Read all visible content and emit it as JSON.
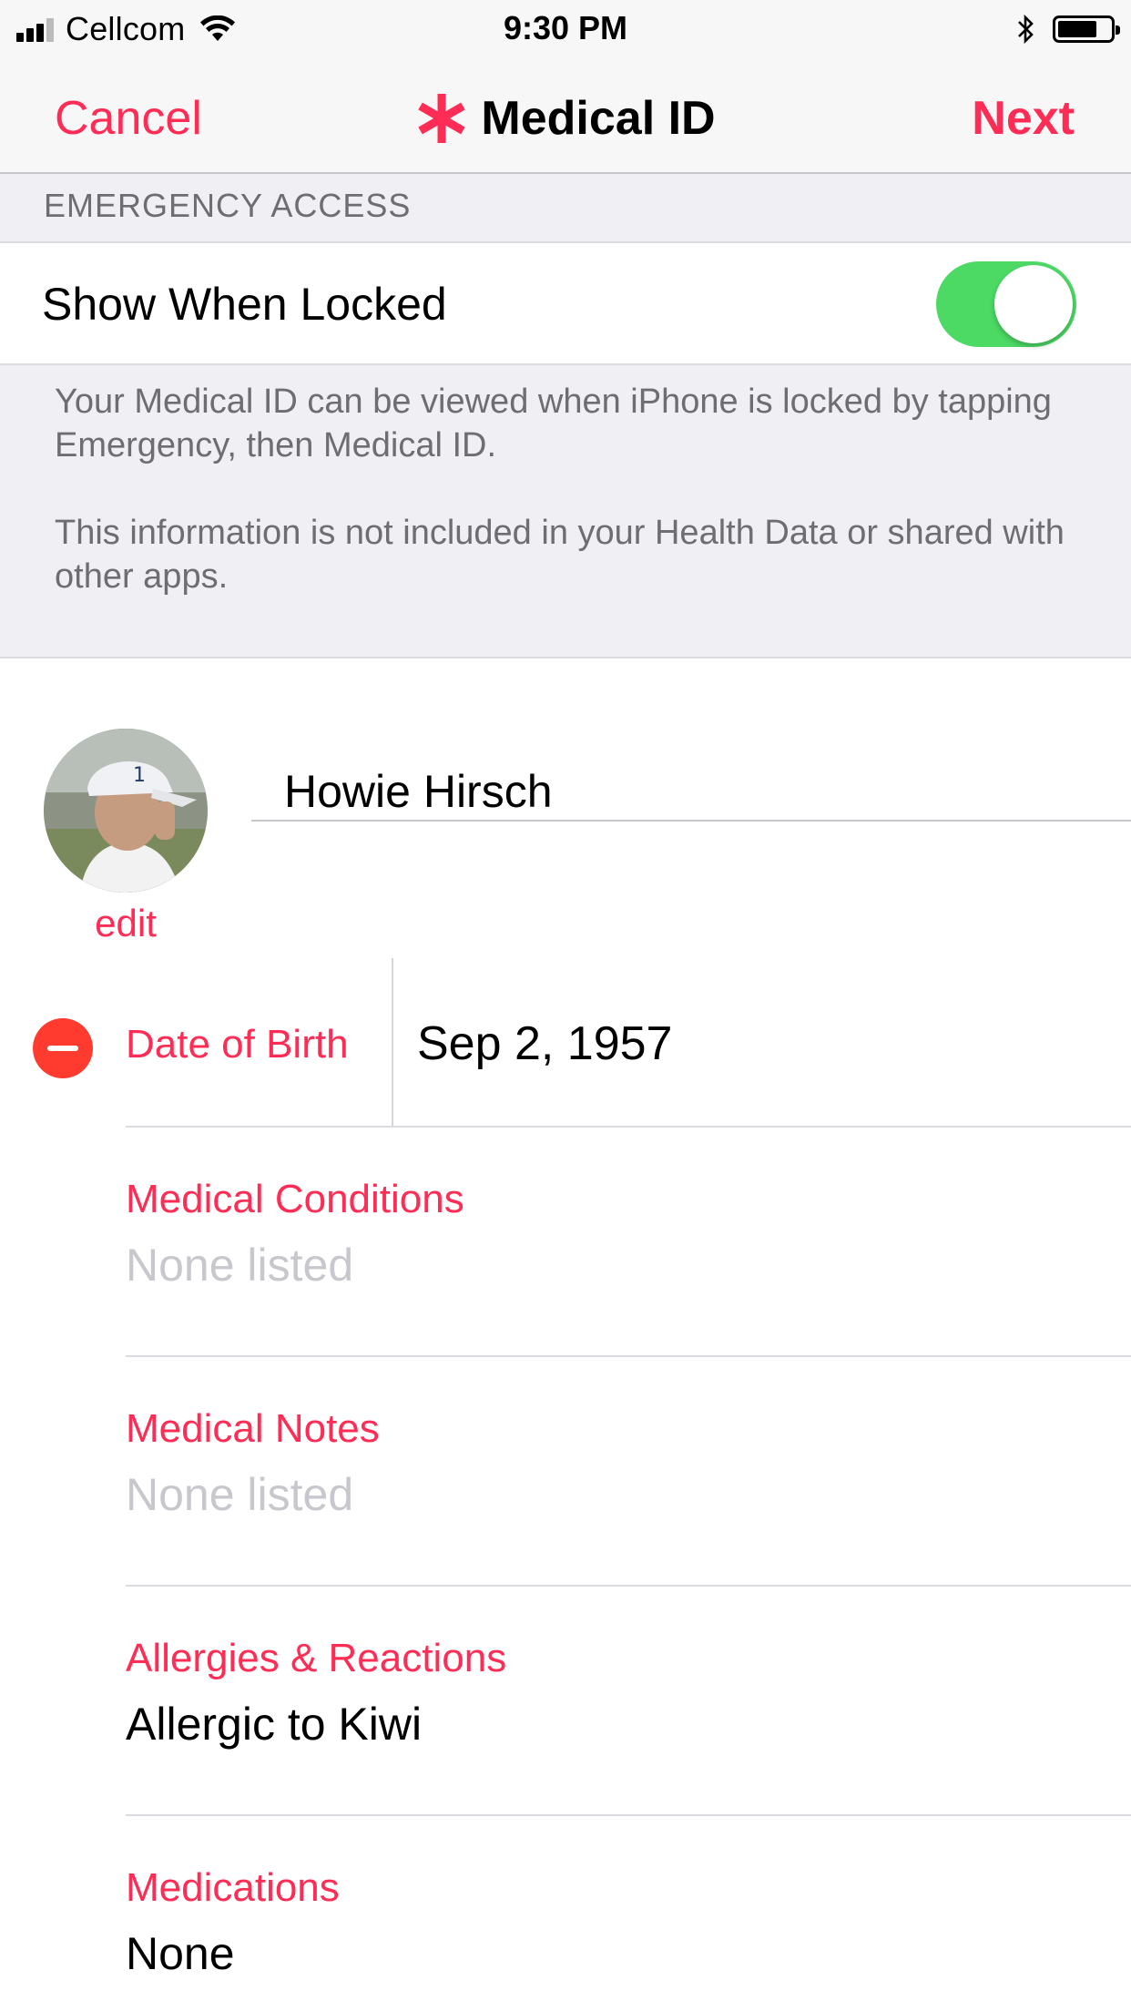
{
  "status_bar": {
    "carrier": "Cellcom",
    "time": "9:30 PM",
    "battery_level": 0.75
  },
  "nav": {
    "cancel_label": "Cancel",
    "title": "Medical ID",
    "next_label": "Next",
    "title_icon": "asterisk-icon",
    "accent_color": "#ff2d55"
  },
  "emergency_access": {
    "section_header": "EMERGENCY ACCESS",
    "toggle_label": "Show When Locked",
    "toggle_on": true,
    "toggle_color": "#4cd964",
    "note_line1": "Your Medical ID can be viewed when iPhone is locked by tapping Emergency, then Medical ID.",
    "note_line2": "This information is not included in your Health Data or shared with other apps."
  },
  "profile": {
    "name": "Howie Hirsch",
    "edit_label": "edit",
    "date_of_birth_label": "Date of Birth",
    "date_of_birth": "Sep 2, 1957"
  },
  "fields": [
    {
      "label": "Medical Conditions",
      "value": "None listed",
      "is_placeholder": true
    },
    {
      "label": "Medical Notes",
      "value": "None listed",
      "is_placeholder": true
    },
    {
      "label": "Allergies & Reactions",
      "value": "Allergic to Kiwi",
      "is_placeholder": false
    },
    {
      "label": "Medications",
      "value": "None",
      "is_placeholder": false
    }
  ]
}
